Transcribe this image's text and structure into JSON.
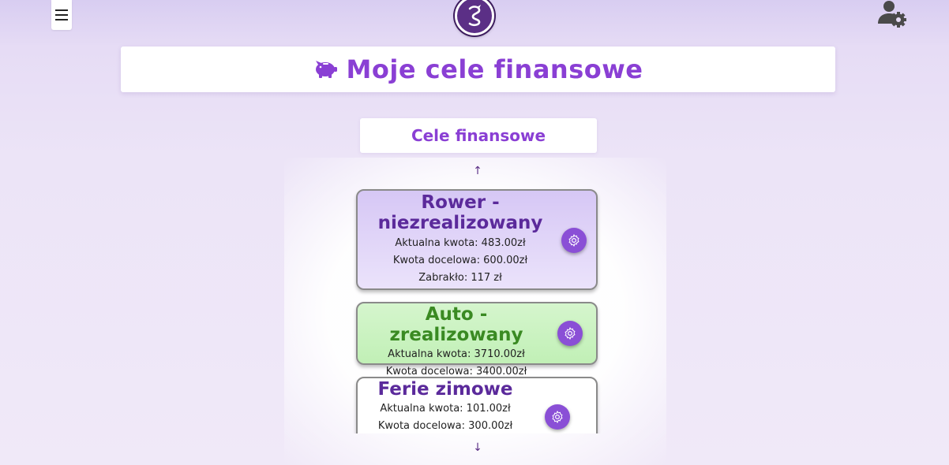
{
  "header": {
    "menu_icon": "hamburger-icon",
    "logo_icon": "dragon-logo",
    "user_settings_icon": "user-gear-icon"
  },
  "page": {
    "title": "Moje cele finansowe",
    "title_icon": "piggy-bank-icon",
    "section_label": "Cele finansowe"
  },
  "colors": {
    "accent": "#8a3fd4",
    "unrealized_bg": "#d6c7f5",
    "realized_bg": "#c1f0b6",
    "realized_text": "#3a8a22"
  },
  "nav": {
    "up_icon": "arrow-up-icon",
    "down_icon": "arrow-down-icon",
    "up": "↑",
    "down": "↓"
  },
  "goals": [
    {
      "title": "Rower - niezrealizowany",
      "current": "Aktualna kwota: 483.00zł",
      "target": "Kwota docelowa: 600.00zł",
      "missing": "Zabrakło: 117 zł"
    },
    {
      "title": "Auto - zrealizowany",
      "current": "Aktualna kwota: 3710.00zł",
      "target": "Kwota docelowa: 3400.00zł"
    },
    {
      "title": "Ferie zimowe",
      "current": "Aktualna kwota: 101.00zł",
      "target": "Kwota docelowa: 300.00zł"
    }
  ]
}
